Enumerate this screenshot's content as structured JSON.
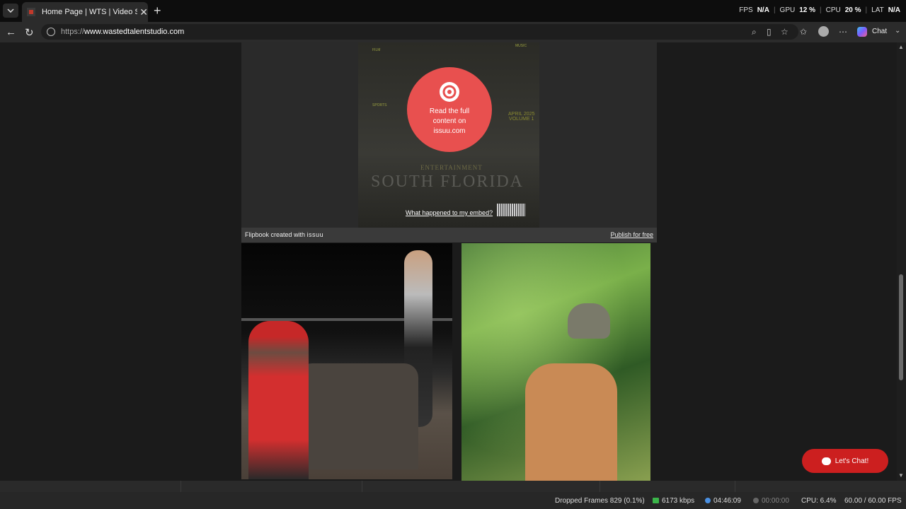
{
  "browser": {
    "tab_title": "Home Page | WTS | Video Services",
    "url_prefix": "https://",
    "url_host": "www.wastedtalentstudio.com",
    "chat_label": "Chat"
  },
  "perf_overlay": {
    "fps_label": "FPS",
    "fps_value": "N/A",
    "gpu_label": "GPU",
    "gpu_value": "12 %",
    "cpu_label": "CPU",
    "cpu_value": "20 %",
    "lat_label": "LAT",
    "lat_value": "N/A"
  },
  "cover": {
    "film_heading": "FILM",
    "sports_heading": "SPORTS",
    "music_heading": "MUSIC",
    "date": "APRIL 2025",
    "volume": "VOLUME 1",
    "entertainment": "ENTERTAINMENT",
    "title": "SOUTH FLORIDA"
  },
  "embed": {
    "cta": "Read the full content on issuu.com",
    "what_happened": "What happened to my embed?",
    "flipbook_label": "Flipbook created with",
    "issuu_brand": "issuu",
    "publish_free": "Publish for free"
  },
  "chat_widget": {
    "label": "Let's Chat!"
  },
  "statusbar": {
    "dropped_frames": "Dropped Frames 829 (0.1%)",
    "bitrate": "6173 kbps",
    "stream_time": "04:46:09",
    "rec_time": "00:00:00",
    "cpu": "CPU: 6.4%",
    "fps": "60.00 / 60.00 FPS"
  },
  "colors": {
    "issuu_red": "#e8504f",
    "chat_red": "#cc1f1f"
  }
}
